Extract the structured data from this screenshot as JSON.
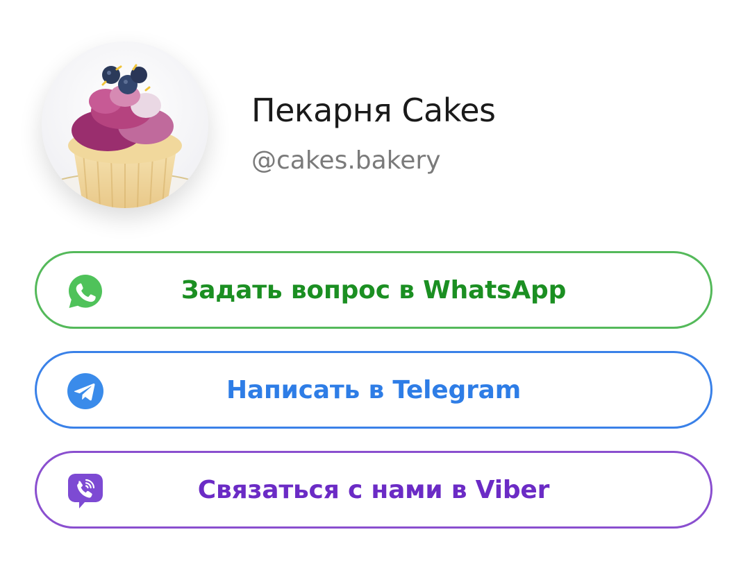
{
  "profile": {
    "name": "Пекарня Cakes",
    "handle": "@cakes.bakery",
    "avatar_icon": "cupcake-photo"
  },
  "buttons": [
    {
      "label": "Задать вопрос в WhatsApp",
      "icon": "whatsapp-icon",
      "color": "#1b8f22",
      "border": "#54b95a"
    },
    {
      "label": "Написать в Telegram",
      "icon": "telegram-icon",
      "color": "#2e7de6",
      "border": "#3a81e8"
    },
    {
      "label": "Связаться с нами в Viber",
      "icon": "viber-icon",
      "color": "#6b2bc5",
      "border": "#8a4fcf"
    }
  ]
}
